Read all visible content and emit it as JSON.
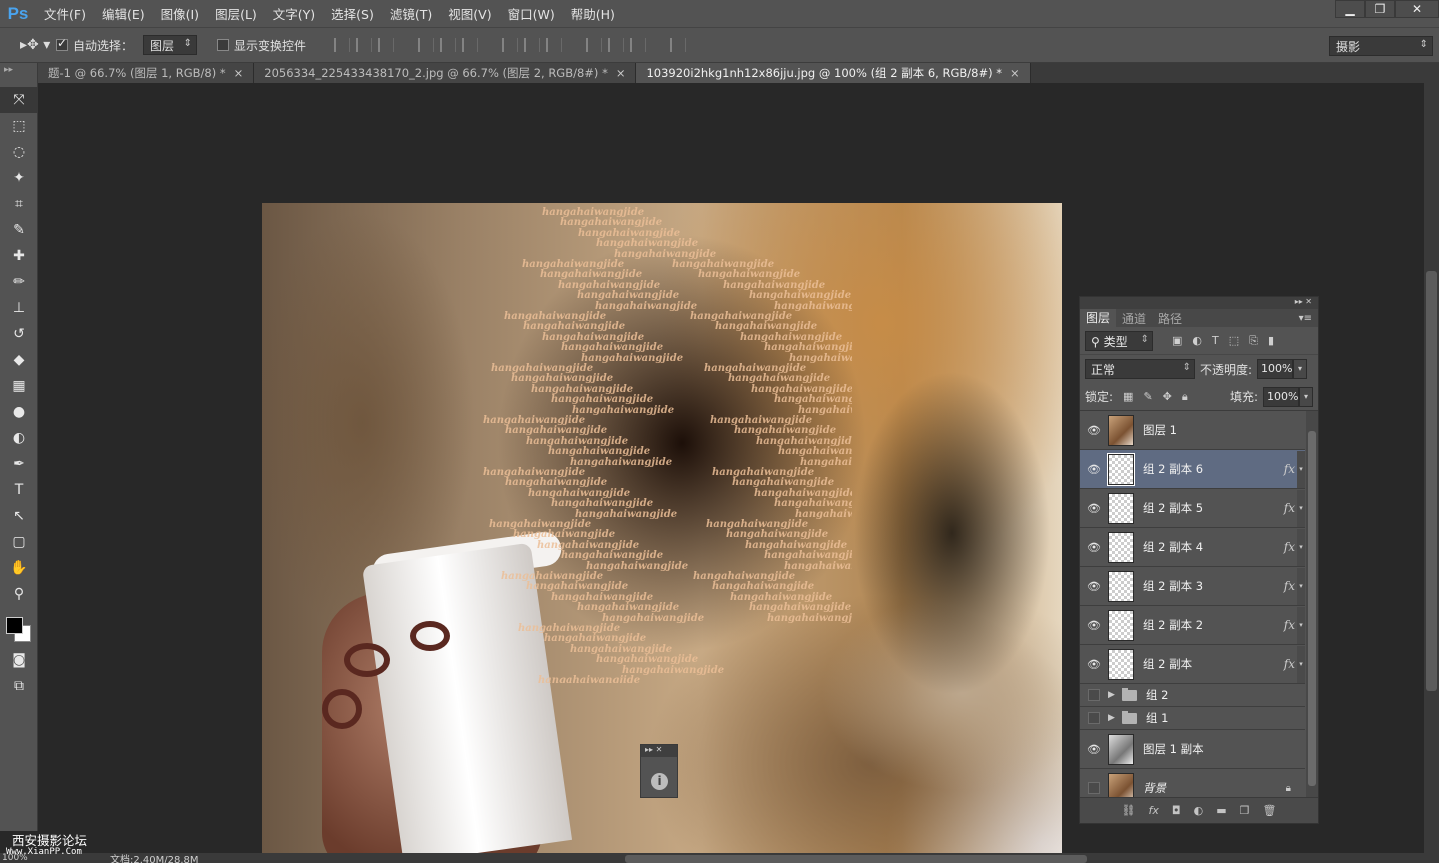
{
  "app": {
    "logo": "Ps"
  },
  "menu": [
    "文件(F)",
    "编辑(E)",
    "图像(I)",
    "图层(L)",
    "文字(Y)",
    "选择(S)",
    "滤镜(T)",
    "视图(V)",
    "窗口(W)",
    "帮助(H)"
  ],
  "window_controls": {
    "minimize": "▁",
    "restore": "❐",
    "close": "✕"
  },
  "options": {
    "tool_icon": "move-tool-icon",
    "auto_select_label": "自动选择：",
    "auto_select_checked": true,
    "auto_select_target": "图层",
    "show_transform_label": "显示变换控件",
    "show_transform_checked": false,
    "workspace": "摄影"
  },
  "tabs": [
    {
      "label": "题-1 @ 66.7% (图层 1, RGB/8) *",
      "active": false
    },
    {
      "label": "2056334_225433438170_2.jpg @ 66.7% (图层 2, RGB/8#) *",
      "active": false
    },
    {
      "label": "103920i2hkg1nh12x86jju.jpg @ 100% (组 2 副本 6, RGB/8#) *",
      "active": true
    }
  ],
  "tab_close": "×",
  "tools": [
    "move-tool-icon",
    "marquee-tool-icon",
    "lasso-tool-icon",
    "magic-wand-icon",
    "crop-tool-icon",
    "eyedropper-icon",
    "healing-brush-icon",
    "brush-tool-icon",
    "clone-stamp-icon",
    "history-brush-icon",
    "eraser-icon",
    "gradient-icon",
    "blur-icon",
    "dodge-icon",
    "pen-tool-icon",
    "type-tool-icon",
    "path-select-icon",
    "shape-tool-icon",
    "hand-tool-icon",
    "zoom-tool-icon"
  ],
  "tool_glyphs": [
    "⤧",
    "⬚",
    "◌",
    "✦",
    "⌗",
    "✎",
    "✚",
    "✏",
    "⊥",
    "↺",
    "◆",
    "▦",
    "●",
    "◐",
    "✒",
    "T",
    "↖",
    "▢",
    "✋",
    "⚲"
  ],
  "canvas_text": "hangahaiwangjide",
  "info_panel": {
    "icon": "i"
  },
  "layers_panel": {
    "tabs": [
      "图层",
      "通道",
      "路径"
    ],
    "filter_type": "类型",
    "blend_mode": "正常",
    "opacity_label": "不透明度:",
    "opacity": "100%",
    "lock_label": "锁定:",
    "fill_label": "填充:",
    "fill": "100%",
    "layers": [
      {
        "name": "图层 1",
        "visible": true,
        "kind": "photo",
        "fx": false,
        "selected": false
      },
      {
        "name": "组 2 副本 6",
        "visible": true,
        "kind": "transparent",
        "fx": true,
        "selected": true
      },
      {
        "name": "组 2 副本 5",
        "visible": true,
        "kind": "transparent",
        "fx": true,
        "selected": false
      },
      {
        "name": "组 2 副本 4",
        "visible": true,
        "kind": "transparent",
        "fx": true,
        "selected": false
      },
      {
        "name": "组 2 副本 3",
        "visible": true,
        "kind": "transparent",
        "fx": true,
        "selected": false
      },
      {
        "name": "组 2 副本 2",
        "visible": true,
        "kind": "transparent",
        "fx": true,
        "selected": false
      },
      {
        "name": "组 2 副本",
        "visible": true,
        "kind": "transparent",
        "fx": true,
        "selected": false
      },
      {
        "name": "组 2",
        "visible": false,
        "kind": "group",
        "fx": false,
        "selected": false
      },
      {
        "name": "组 1",
        "visible": false,
        "kind": "group",
        "fx": false,
        "selected": false
      },
      {
        "name": "图层 1 副本",
        "visible": true,
        "kind": "bw",
        "fx": false,
        "selected": false
      },
      {
        "name": "背景",
        "visible": false,
        "kind": "photo",
        "fx": false,
        "selected": false,
        "locked": true
      }
    ],
    "fx_label": "fx"
  },
  "status": {
    "zoom": "100%",
    "doc_size": "文档:2.40M/28.8M"
  },
  "watermark": {
    "title": "西安摄影论坛",
    "url": "Www.XianPP.Com"
  },
  "colors": {
    "ui_bg": "#535353",
    "canvas_bg": "#282828",
    "selected_layer": "#5f6b82",
    "ps_blue": "#4aa4ef"
  }
}
